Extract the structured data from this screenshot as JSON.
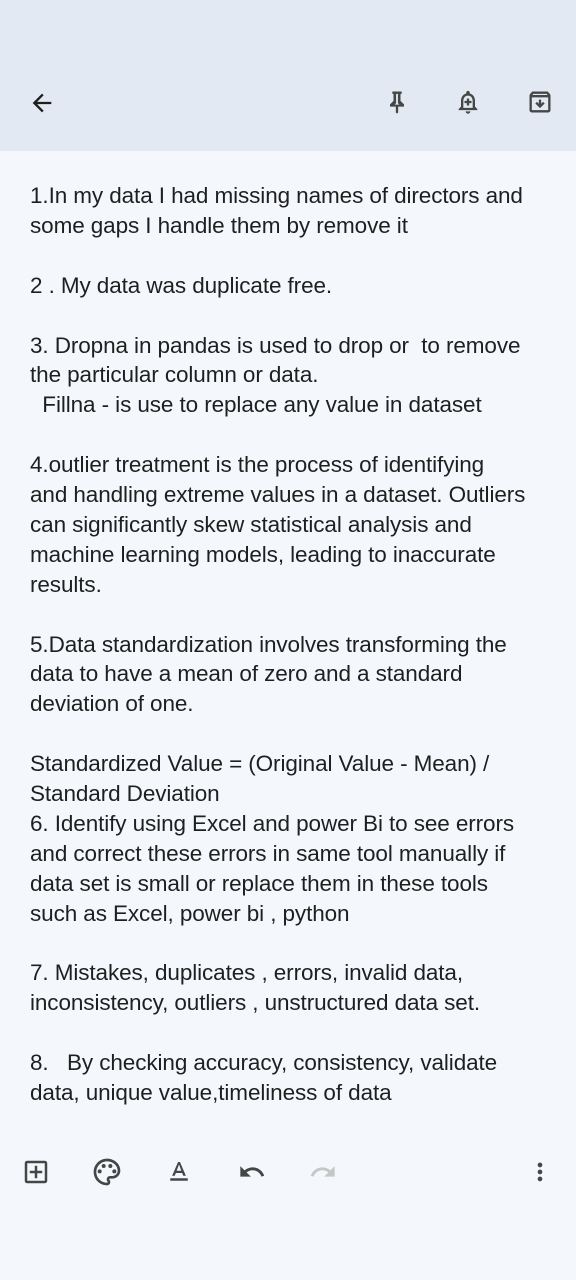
{
  "toolbar": {
    "back_icon": "arrow-left-icon",
    "pin_icon": "pin-icon",
    "reminder_icon": "bell-plus-icon",
    "archive_icon": "archive-icon"
  },
  "note": {
    "lines": [
      "1.In my data I had missing names of directors and",
      "some gaps I handle them by remove it",
      "",
      "2 . My data was duplicate free.",
      "",
      "3. Dropna in pandas is used to drop or  to remove",
      "the particular column or data.",
      "  Fillna - is use to replace any value in dataset",
      "",
      "4.outlier treatment is the process of identifying",
      "and handling extreme values in a dataset. Outliers",
      "can significantly skew statistical analysis and",
      "machine learning models, leading to inaccurate",
      "results.",
      "",
      "5.Data standardization involves transforming the",
      "data to have a mean of zero and a standard",
      "deviation of one.",
      "",
      "Standardized Value = (Original Value - Mean) /",
      "Standard Deviation",
      "6. Identify using Excel and power Bi to see errors",
      "and correct these errors in same tool manually if",
      "data set is small or replace them in these tools",
      "such as Excel, power bi , python",
      "",
      "7. Mistakes, duplicates , errors, invalid data,",
      "inconsistency, outliers , unstructured data set.",
      "",
      "8.   By checking accuracy, consistency, validate",
      "data, unique value,timeliness of data"
    ]
  },
  "bottom_toolbar": {
    "add_icon": "add-box-icon",
    "palette_icon": "palette-icon",
    "text_format_icon": "text-format-icon",
    "undo_icon": "undo-icon",
    "redo_icon": "redo-icon",
    "more_icon": "more-vert-icon"
  },
  "colors": {
    "background": "#f4f8fd",
    "topbar": "#e3e9f2",
    "icon": "#444746",
    "disabled_icon": "#c4c7c5",
    "text": "#1f1f1f"
  }
}
